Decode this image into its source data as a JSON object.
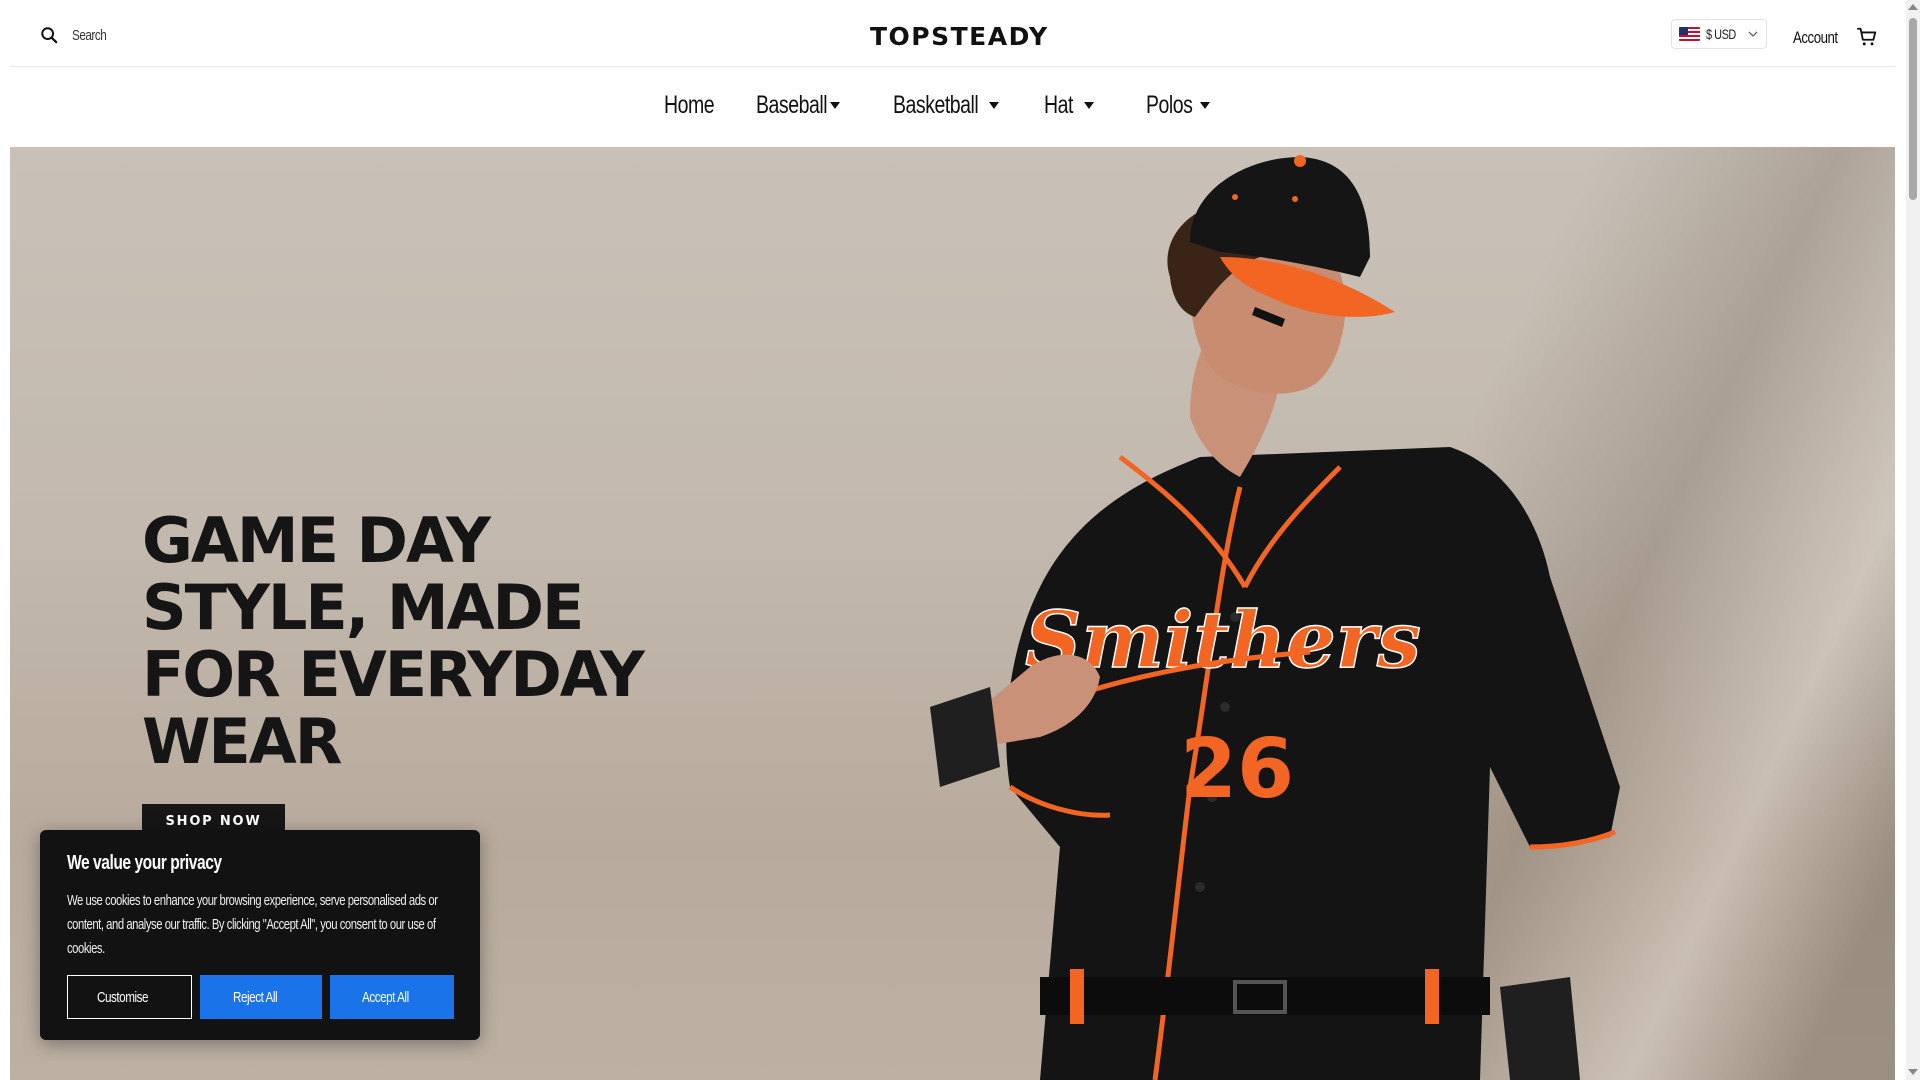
{
  "header": {
    "search_placeholder": "Search",
    "logo": "TOPSTEADY",
    "currency": "$ USD",
    "account": "Account",
    "icons": {
      "search": "search-icon",
      "cart": "cart-icon",
      "flag": "us-flag-icon",
      "chevron": "chevron-down-icon"
    }
  },
  "nav": {
    "items": [
      {
        "label": "Home",
        "active": true,
        "dropdown": false
      },
      {
        "label": "Baseball",
        "active": false,
        "dropdown": true
      },
      {
        "label": "Basketball",
        "active": false,
        "dropdown": true
      },
      {
        "label": "Hat",
        "active": false,
        "dropdown": true
      },
      {
        "label": "Polos",
        "active": false,
        "dropdown": true
      }
    ]
  },
  "hero": {
    "title_lines": [
      "GAME DAY",
      "STYLE, MADE",
      "FOR EVERYDAY",
      "WEAR"
    ],
    "cta": "SHOP NOW",
    "jersey_text": "Smithers",
    "jersey_number": "26",
    "accent_color": "#f26522"
  },
  "cookie": {
    "title": "We value your privacy",
    "body": "We use cookies to enhance your browsing experience, serve personalised ads or content, and analyse our traffic. By clicking \"Accept All\", you consent to our use of cookies.",
    "customise": "Customise",
    "reject": "Reject All",
    "accept": "Accept All",
    "button_color": "#1a73e8"
  }
}
